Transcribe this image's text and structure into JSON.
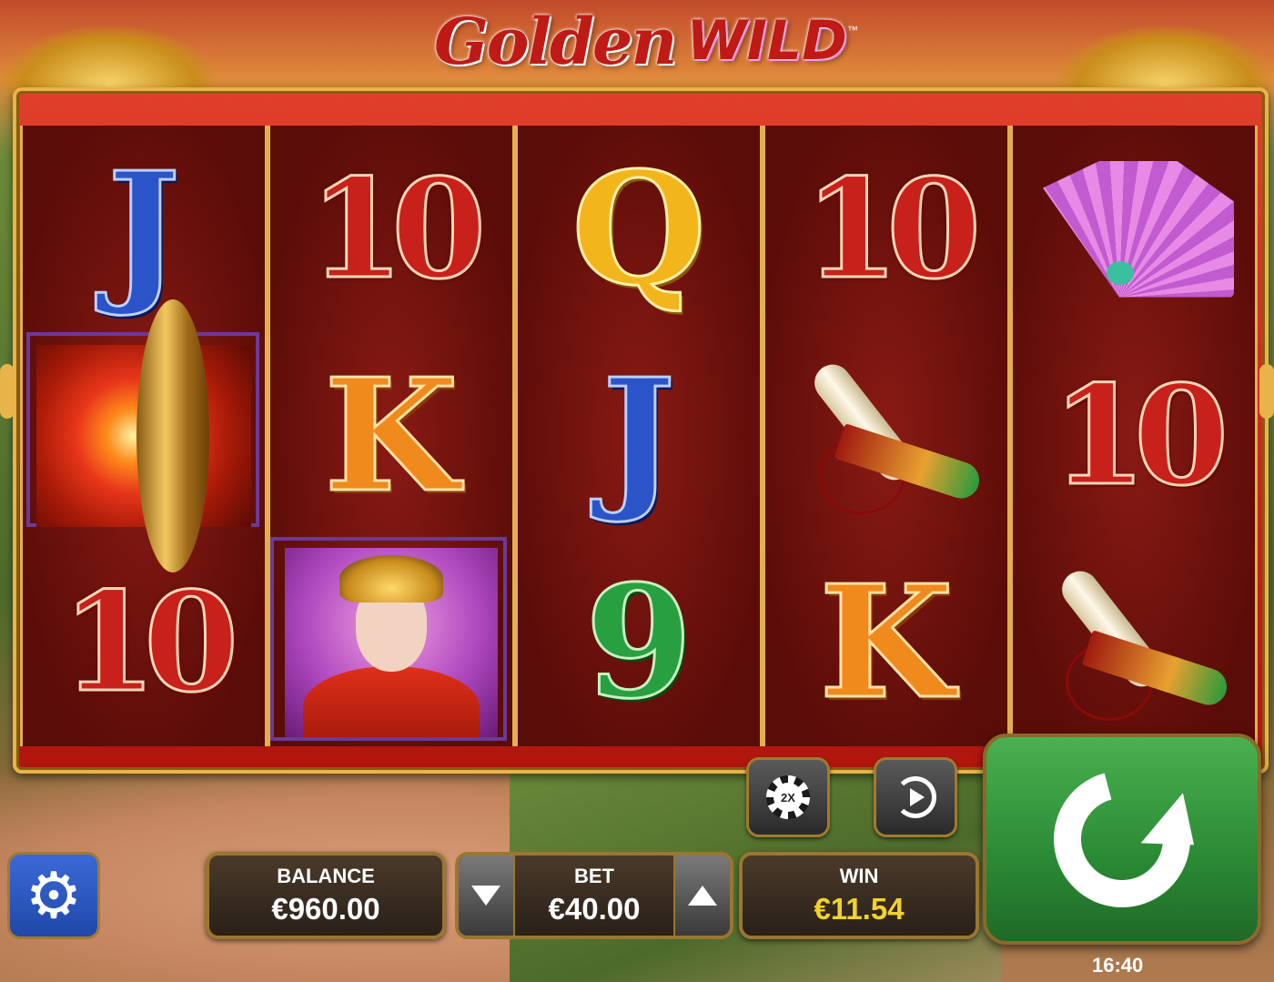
{
  "logo": {
    "word1": "Golden",
    "word2": "WILD",
    "tm": "™"
  },
  "reels": [
    {
      "symbols": [
        {
          "type": "letter",
          "text": "J",
          "color": "blue"
        },
        {
          "type": "image",
          "name": "fire-coin-scatter",
          "highlighted": true
        },
        {
          "type": "letter",
          "text": "10",
          "color": "red"
        }
      ]
    },
    {
      "symbols": [
        {
          "type": "letter",
          "text": "10",
          "color": "red"
        },
        {
          "type": "letter",
          "text": "K",
          "color": "orange"
        },
        {
          "type": "image",
          "name": "empress-wild",
          "highlighted": true
        }
      ]
    },
    {
      "symbols": [
        {
          "type": "letter",
          "text": "Q",
          "color": "gold"
        },
        {
          "type": "letter",
          "text": "J",
          "color": "blue"
        },
        {
          "type": "letter",
          "text": "9",
          "color": "green"
        }
      ]
    },
    {
      "symbols": [
        {
          "type": "letter",
          "text": "10",
          "color": "red"
        },
        {
          "type": "image",
          "name": "scroll-horn"
        },
        {
          "type": "letter",
          "text": "K",
          "color": "orange"
        }
      ]
    },
    {
      "symbols": [
        {
          "type": "image",
          "name": "pink-fan"
        },
        {
          "type": "letter",
          "text": "10",
          "color": "red"
        },
        {
          "type": "image",
          "name": "scroll-horn"
        }
      ]
    }
  ],
  "controls": {
    "double_label": "2X",
    "settings_icon": "gear-icon",
    "autoplay_icon": "autoplay-icon",
    "spin_icon": "spin-icon"
  },
  "balance": {
    "label": "BALANCE",
    "value": "€960.00"
  },
  "bet": {
    "label": "BET",
    "value": "€40.00"
  },
  "win": {
    "label": "WIN",
    "value": "€11.54"
  },
  "clock": "16:40",
  "colors": {
    "frame_red": "#c01a16",
    "gold_border": "#e8b44a",
    "spin_green": "#2a8a34",
    "settings_blue": "#2a5ac8",
    "win_yellow": "#f2d22a"
  }
}
